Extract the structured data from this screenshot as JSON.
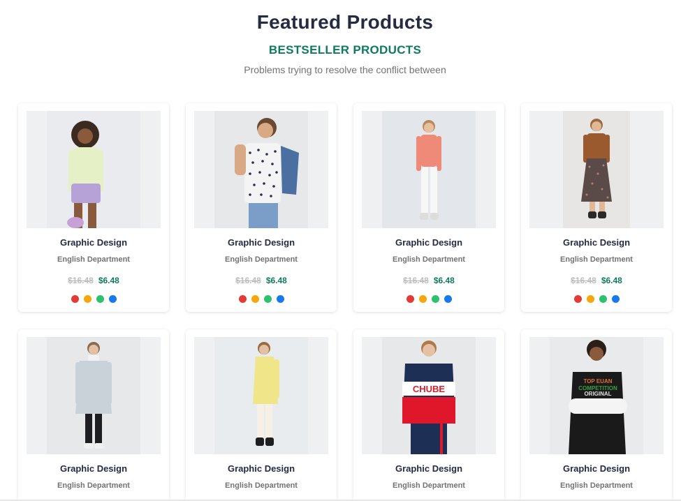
{
  "section": {
    "title": "Featured Products",
    "subtitle": "BESTSELLER PRODUCTS",
    "description": "Problems trying to resolve the conflict between"
  },
  "swatch_colors": [
    "#e53935",
    "#f6a609",
    "#2dc071",
    "#1778f2"
  ],
  "products": [
    {
      "name": "Graphic Design",
      "department": "English Department",
      "old_price": "$16.48",
      "price": "$6.48",
      "image": "woman-green-top-purple-shorts"
    },
    {
      "name": "Graphic Design",
      "department": "English Department",
      "old_price": "$16.48",
      "price": "$6.48",
      "image": "man-printed-tee-denim-jacket"
    },
    {
      "name": "Graphic Design",
      "department": "English Department",
      "old_price": "$16.48",
      "price": "$6.48",
      "image": "woman-coral-top-white-jeans"
    },
    {
      "name": "Graphic Design",
      "department": "English Department",
      "old_price": "$16.48",
      "price": "$6.48",
      "image": "woman-brown-jacket-floral-skirt"
    },
    {
      "name": "Graphic Design",
      "department": "English Department",
      "image": "man-grey-parka"
    },
    {
      "name": "Graphic Design",
      "department": "English Department",
      "image": "woman-yellow-cardigan"
    },
    {
      "name": "Graphic Design",
      "department": "English Department",
      "image": "man-colorblock-hoodie"
    },
    {
      "name": "Graphic Design",
      "department": "English Department",
      "image": "man-black-graphic-tee"
    }
  ]
}
